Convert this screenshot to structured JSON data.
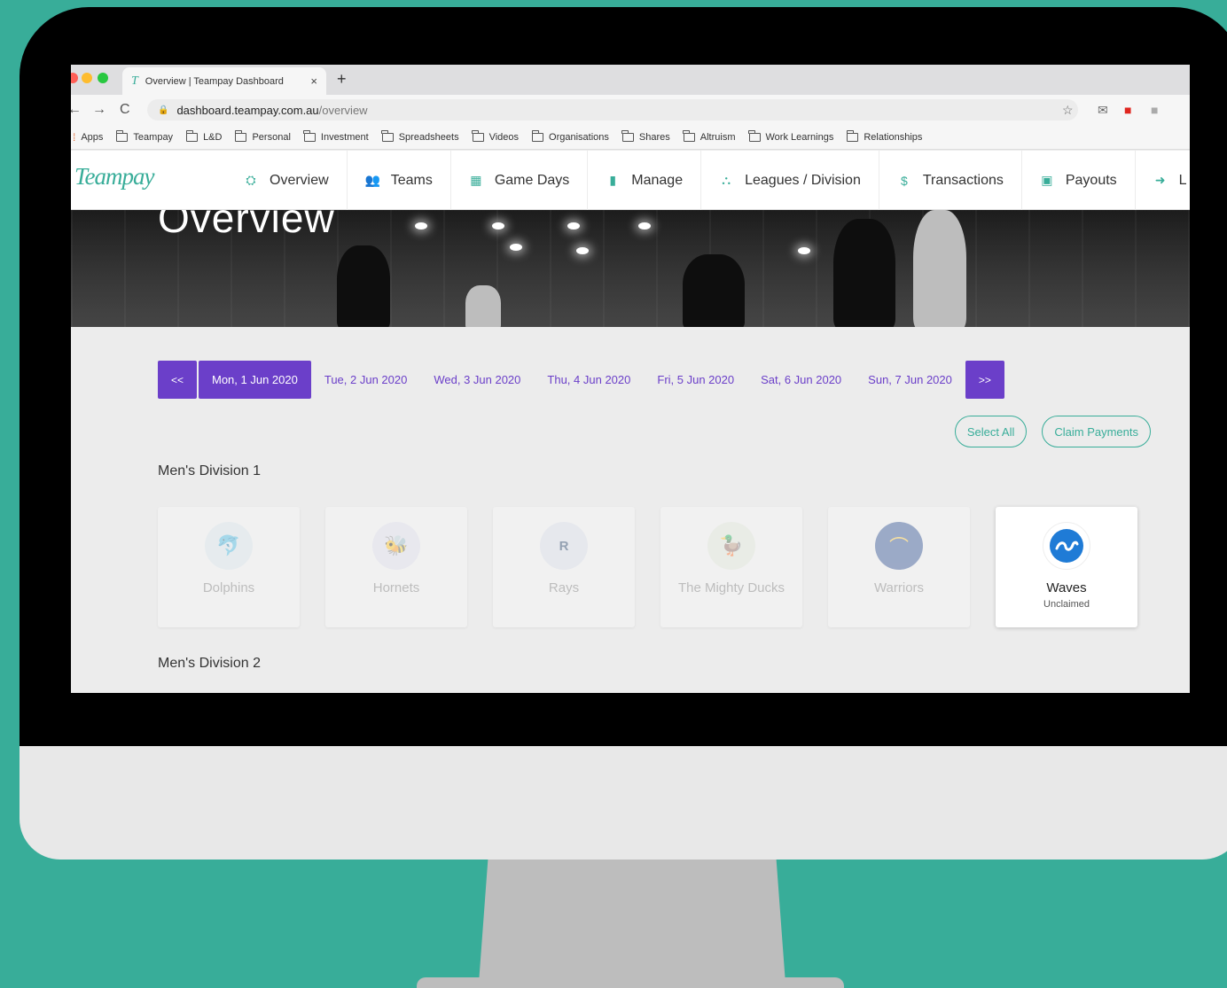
{
  "browser": {
    "tab_title": "Overview | Teampay Dashboard",
    "tab_close": "×",
    "new_tab": "+",
    "url_host": "dashboard.teampay.com.au",
    "url_path": "/overview",
    "bookmarks": [
      "Apps",
      "Teampay",
      "L&D",
      "Personal",
      "Investment",
      "Spreadsheets",
      "Videos",
      "Organisations",
      "Shares",
      "Altruism",
      "Work Learnings",
      "Relationships"
    ]
  },
  "site": {
    "logo": "Teampay",
    "nav": [
      {
        "label": "Overview",
        "icon": "binoculars-icon"
      },
      {
        "label": "Teams",
        "icon": "users-icon"
      },
      {
        "label": "Game Days",
        "icon": "calendar-icon"
      },
      {
        "label": "Manage",
        "icon": "clipboard-icon"
      },
      {
        "label": "Leagues / Division",
        "icon": "sitemap-icon"
      },
      {
        "label": "Transactions",
        "icon": "dollar-icon"
      },
      {
        "label": "Payouts",
        "icon": "money-icon"
      },
      {
        "label": "L",
        "icon": "logout-icon"
      }
    ],
    "hero_title": "Overview"
  },
  "dates": {
    "prev": "<<",
    "next": ">>",
    "days": [
      "Mon, 1 Jun 2020",
      "Tue, 2 Jun 2020",
      "Wed, 3 Jun 2020",
      "Thu, 4 Jun 2020",
      "Fri, 5 Jun 2020",
      "Sat, 6 Jun 2020",
      "Sun, 7 Jun 2020"
    ],
    "active_index": 0
  },
  "actions": {
    "select_all": "Select All",
    "claim_payments": "Claim Payments"
  },
  "divisions": [
    {
      "name": "Men's Division 1",
      "teams": [
        {
          "name": "Dolphins",
          "status": "",
          "emblem": "dolphin-icon",
          "active": false
        },
        {
          "name": "Hornets",
          "status": "",
          "emblem": "hornet-icon",
          "active": false
        },
        {
          "name": "Rays",
          "status": "",
          "emblem": "rays-icon",
          "active": false
        },
        {
          "name": "The Mighty Ducks",
          "status": "",
          "emblem": "duck-icon",
          "active": false
        },
        {
          "name": "Warriors",
          "status": "",
          "emblem": "bridge-icon",
          "active": false
        },
        {
          "name": "Waves",
          "status": "Unclaimed",
          "emblem": "wave-icon",
          "active": true
        }
      ]
    },
    {
      "name": "Men's Division 2",
      "teams": []
    }
  ],
  "colors": {
    "background": "#38ad99",
    "accent_purple": "#6b3fc9",
    "accent_teal": "#38ad99"
  }
}
